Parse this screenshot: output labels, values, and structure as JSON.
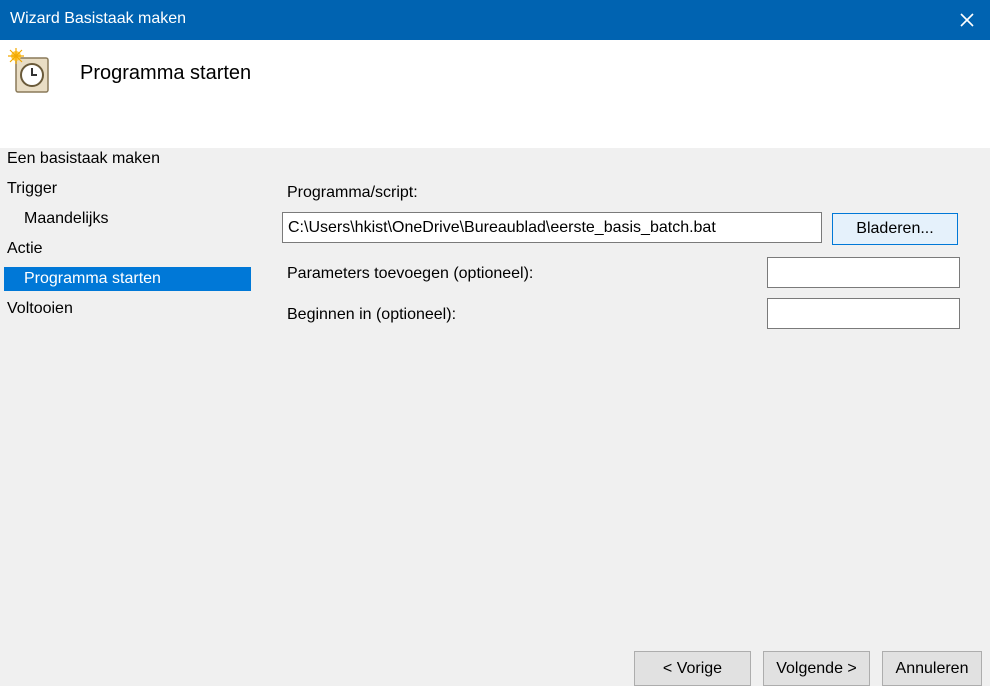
{
  "window": {
    "title": "Wizard Basistaak maken"
  },
  "header": {
    "title": "Programma starten",
    "icon": "clock-icon"
  },
  "steps": [
    {
      "label": "Een basistaak maken"
    },
    {
      "label": "Trigger"
    },
    {
      "label": "Maandelijks"
    },
    {
      "label": "Actie"
    },
    {
      "label": "Programma starten"
    },
    {
      "label": "Voltooien"
    }
  ],
  "form": {
    "program_label": "Programma/script:",
    "program_value": "C:\\Users\\hkist\\OneDrive\\Bureaublad\\eerste_basis_batch.bat",
    "browse_label": "Bladeren...",
    "params_label": "Parameters toevoegen (optioneel):",
    "params_value": "",
    "startin_label": "Beginnen in (optioneel):",
    "startin_value": ""
  },
  "footer": {
    "back": "< Vorige",
    "next": "Volgende >",
    "cancel": "Annuleren"
  },
  "colors": {
    "titlebar": "#0063b1",
    "selection": "#0078d7",
    "background": "#f0f0f0"
  }
}
